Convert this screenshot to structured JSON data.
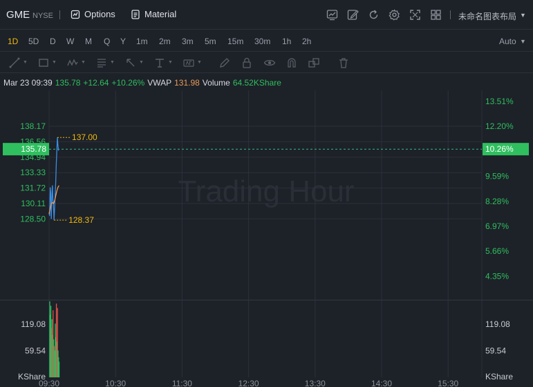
{
  "header": {
    "symbol": "GME",
    "exchange": "NYSE",
    "options_label": "Options",
    "material_label": "Material",
    "layout_name": "未命名图表布局"
  },
  "intervals": [
    "1D",
    "5D",
    "D",
    "W",
    "M",
    "Q",
    "Y",
    "1m",
    "2m",
    "3m",
    "5m",
    "15m",
    "30m",
    "1h",
    "2h"
  ],
  "active_interval": "1D",
  "scale_mode": "Auto",
  "info": {
    "time": "Mar 23 09:39",
    "price": "135.78",
    "change": "+12.64",
    "change_pct": "+10.26%",
    "vwap_label": "VWAP",
    "vwap": "131.98",
    "volume_label": "Volume",
    "volume": "64.52KShare"
  },
  "colors": {
    "up": "#2fbf5f",
    "down": "#e0534a",
    "price_line": "#3a8ee6",
    "vwap_line": "#e89a5a",
    "hilo": "#f0b90b",
    "grid": "#2c313a",
    "bg": "#1d2128"
  },
  "chart_data": {
    "type": "line",
    "watermark": "Trading Hour",
    "x_ticks": [
      "09:30",
      "10:30",
      "11:30",
      "12:30",
      "13:30",
      "14:30",
      "15:30"
    ],
    "y_ticks_left": [
      "138.17",
      "136.56",
      "134.94",
      "133.33",
      "131.72",
      "130.11",
      "128.50"
    ],
    "y_ticks_right": [
      "13.51%",
      "12.20%",
      "10.89%",
      "9.59%",
      "8.28%",
      "6.97%",
      "5.66%",
      "4.35%"
    ],
    "y_ticks_values": [
      138.17,
      136.56,
      134.94,
      133.33,
      131.72,
      130.11,
      128.5
    ],
    "ylim": [
      127.5,
      139.7
    ],
    "session_start": "09:30",
    "session_minutes": 390,
    "current_price": 135.78,
    "current_price_label": "135.78",
    "current_pct_label": "10.26%",
    "high": 137.0,
    "high_label": "137.00",
    "low": 128.37,
    "low_label": "128.37",
    "series": [
      {
        "kind": "price",
        "minutes": [
          0,
          0.5,
          1,
          1.5,
          2,
          2.5,
          3,
          3.5,
          4,
          4.5,
          5,
          5.5,
          6,
          6.5,
          7,
          7.5,
          8,
          8.5,
          9
        ],
        "values": [
          129.2,
          128.8,
          131.8,
          131.2,
          128.5,
          130.6,
          132.0,
          130.5,
          129.8,
          128.37,
          129.6,
          131.0,
          132.3,
          134.2,
          135.6,
          137.0,
          136.2,
          135.7,
          135.78
        ]
      },
      {
        "kind": "vwap",
        "minutes": [
          0,
          1,
          2,
          3,
          4,
          5,
          6,
          7,
          8,
          9
        ],
        "values": [
          129.0,
          129.6,
          130.1,
          130.2,
          130.1,
          130.4,
          130.9,
          131.4,
          131.8,
          131.98
        ]
      }
    ],
    "volume": {
      "y_ticks_labels": [
        "119.08",
        "59.54"
      ],
      "y_ticks_values": [
        119.08,
        59.54
      ],
      "ylim": [
        0,
        190
      ],
      "unit": "KShare",
      "minutes": [
        0,
        0.5,
        1,
        1.5,
        2,
        2.5,
        3,
        3.5,
        4,
        4.5,
        5,
        5.5,
        6,
        6.5,
        7,
        7.5,
        8,
        8.5
      ],
      "values": [
        170,
        140,
        160,
        110,
        130,
        95,
        150,
        85,
        70,
        60,
        120,
        90,
        165,
        80,
        155,
        60,
        45,
        35
      ],
      "direction": [
        "up",
        "up",
        "up",
        "down",
        "up",
        "up",
        "down",
        "up",
        "down",
        "up",
        "up",
        "up",
        "down",
        "up",
        "down",
        "up",
        "up",
        "up"
      ]
    }
  }
}
